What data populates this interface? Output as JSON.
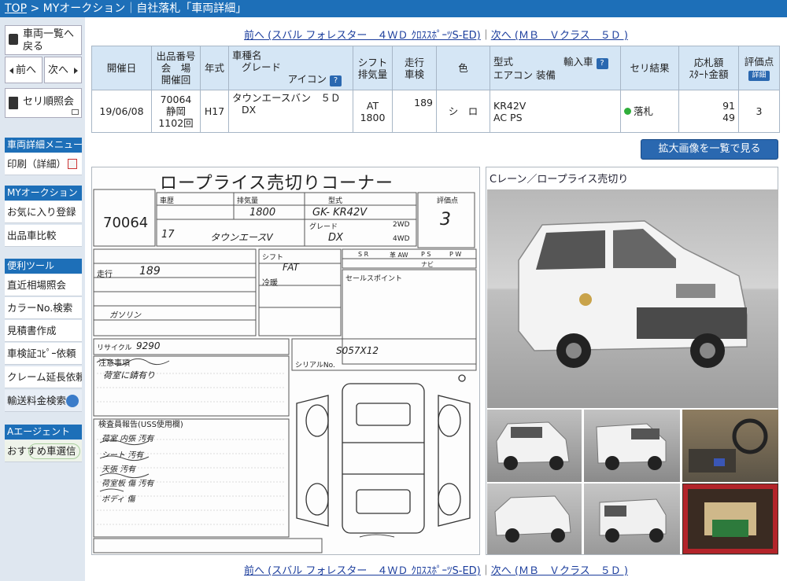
{
  "breadcrumb": {
    "top": "TOP",
    "sep": " > ",
    "my": "MYオークション",
    "bar": "｜",
    "page": "自社落札「車両詳細」"
  },
  "sidebar": {
    "back_list": "車両一覧へ戻る",
    "prev": "前へ",
    "next": "次へ",
    "seri": "セリ順照会",
    "menu_head": "車両詳細メニュー",
    "print": "印刷（詳細）",
    "my_head": "MYオークション",
    "fav": "お気に入り登録",
    "compare": "出品車比較",
    "tools_head": "便利ツール",
    "market": "直近相場照会",
    "color": "カラーNo.検索",
    "estimate": "見積書作成",
    "inspection": "車検証ｺﾋﾟｰ依頼",
    "claim": "クレーム延長依頼",
    "shipping": "輸送料金検索",
    "agent_head": "Aエージェント",
    "recommend": "おすすめ車選信"
  },
  "nav": {
    "prev": "前へ (スバル フォレスター　４ＷＤ ｸﾛｽｽﾎﾟｰﾂS-ED)",
    "divider": "｜",
    "next": "次へ (ＭＢ　Ｖクラス　５Ｄ )"
  },
  "table": {
    "headers": {
      "date": "開催日",
      "lot1": "出品番号",
      "lot2": "会　場",
      "lot3": "開催回",
      "year": "年式",
      "model1": "車種名",
      "model2": "グレード",
      "model3": "アイコン",
      "shift1": "シフト",
      "shift2": "排気量",
      "mileage1": "走行",
      "mileage2": "車検",
      "color": "色",
      "type1": "型式",
      "type2": "輸入車",
      "type3": "エアコン 装備",
      "result": "セリ結果",
      "price1": "応札額",
      "price2": "ｽﾀｰﾄ金額",
      "score1": "評価点",
      "score2": "詳細"
    },
    "row": {
      "date": "19/06/08",
      "lot": "70064",
      "venue": "静岡",
      "round": "1102回",
      "year": "H17",
      "model": "タウンエースバン　５Ｄ",
      "grade": "DX",
      "shift": "AT",
      "displacement": "1800",
      "mileage": "189",
      "color": "シ　ロ",
      "type": "KR42V",
      "equip": "AC PS",
      "result": "落札",
      "bid": "91",
      "start": "49",
      "score": "3"
    }
  },
  "big_button": "拡大画像を一覧で見る",
  "photo_title": "Cレーン／ロープライス売切り",
  "sheet": {
    "title": "ロープライス売切りコーナー",
    "lot": "70064",
    "score": "3",
    "type": "GK- KR42V",
    "cc": "1800",
    "grade": "DX",
    "name": "タウンエースV",
    "year": "17",
    "mileage": "189",
    "fuel": "ガソリン",
    "shift": "FAT",
    "recycle": "9290",
    "chassis": "S057X12",
    "note1": "荷室に錆有り",
    "report": [
      "荷室 内張 汚有",
      "シート 汚有",
      "天張 汚有",
      "荷室板 傷 汚有",
      "ボディ 傷"
    ],
    "labels": {
      "car": "車歴",
      "displacement": "排気量",
      "model_type": "型式",
      "eval": "評価点",
      "grade_lbl": "グレード",
      "mileage_lbl": "走行",
      "shift_lbl": "シフト",
      "ac": "冷暖",
      "recycle_lbl": "リサイクル",
      "notes": "注意事項",
      "inspector": "検査員報告(USS使用欄)",
      "sales": "セールスポイント",
      "twowd": "2WD",
      "fourwd": "4WD",
      "serial": "シリアルNo.",
      "sr": "S R",
      "aw": "革 AW",
      "ps": "P S",
      "pw": "P W",
      "navi": "ナビ"
    }
  },
  "colors": {
    "topbar": "#1d6fb8",
    "header_bg": "#d5e6f5",
    "green": "#2fae3a"
  }
}
